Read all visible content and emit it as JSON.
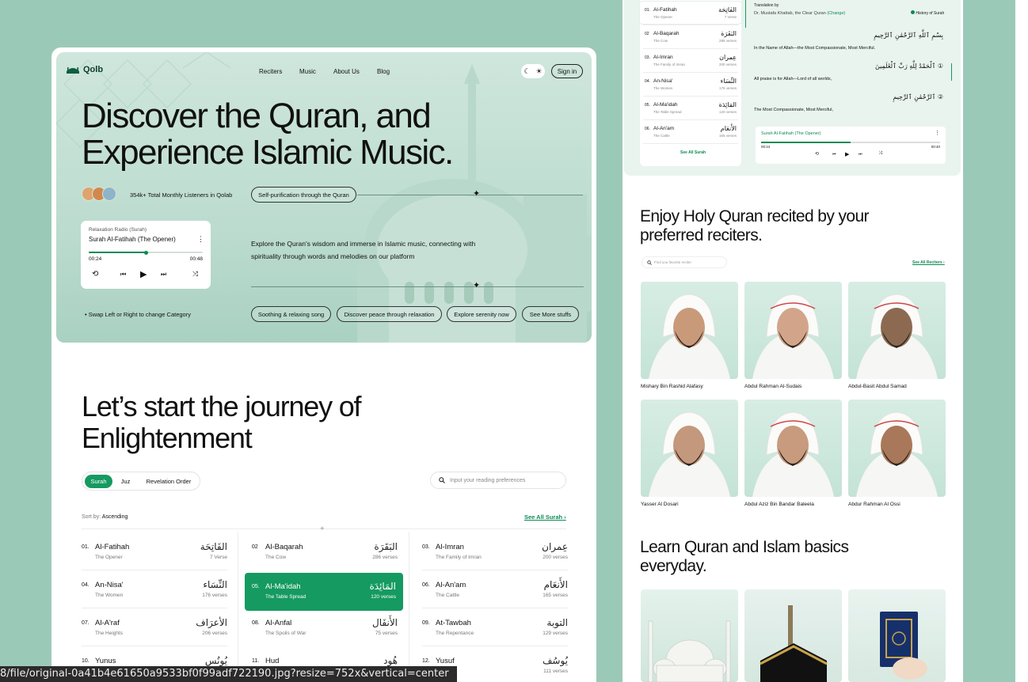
{
  "nav": {
    "brand": "Qolb",
    "links": [
      "Reciters",
      "Music",
      "About Us",
      "Blog"
    ],
    "signin": "Sign in"
  },
  "hero": {
    "title": "Discover the Quran, and Experience Islamic Music.",
    "listeners": "354k+ Total Monthly Listeners in Qolab",
    "tag": "Self-purification through the Quran",
    "description": "Explore the Quran's wisdom and immerse in Islamic music, connecting with spirituality through words and melodies on our platform",
    "swap_hint": "Swap Left or Right to change Category",
    "pills": [
      "Soothing & relaxing song",
      "Discover peace through relaxation",
      "Explore serenity now",
      "See More stuffs"
    ],
    "player": {
      "category": "Relaxation Radio (Surah)",
      "track": "Surah Al-Fatihah (The Opener)",
      "elapsed": "00:24",
      "total": "00:48",
      "progress": 0.5
    }
  },
  "journey": {
    "title": "Let’s start the journey of Enlightenment",
    "tabs": [
      "Surah",
      "Juz",
      "Revelation Order"
    ],
    "search_placeholder": "Input your reading preferences",
    "sort_label": "Sort by:",
    "sort_value": "Ascending",
    "see_all": "See All Surah",
    "surahs": [
      {
        "num": "01.",
        "name": "Al-Fatihah",
        "meaning": "The Opener",
        "arabic": "الفَاتِحَة",
        "verses": "7 Verse"
      },
      {
        "num": "02",
        "name": "Al-Baqarah",
        "meaning": "The Cow",
        "arabic": "البَقَرَة",
        "verses": "286 verses"
      },
      {
        "num": "03.",
        "name": "Al-Imran",
        "meaning": "The Family of Imran",
        "arabic": "عِمران",
        "verses": "200 verses"
      },
      {
        "num": "04.",
        "name": "An-Nisa'",
        "meaning": "The Women",
        "arabic": "النِّسَاء",
        "verses": "176 verses"
      },
      {
        "num": "05.",
        "name": "Al-Ma'idah",
        "meaning": "The Table Spread",
        "arabic": "المَائِدَة",
        "verses": "120 verses"
      },
      {
        "num": "06.",
        "name": "Al-An'am",
        "meaning": "The Cattle",
        "arabic": "الأَنعَام",
        "verses": "165 verses"
      },
      {
        "num": "07.",
        "name": "Al-A'raf",
        "meaning": "The Heights",
        "arabic": "الأعرَاف",
        "verses": "206 verses"
      },
      {
        "num": "08.",
        "name": "Al-Anfal",
        "meaning": "The Spoils of War",
        "arabic": "الأَنفَال",
        "verses": "75 verses"
      },
      {
        "num": "09.",
        "name": "At-Tawbah",
        "meaning": "The Repentance",
        "arabic": "التوبة",
        "verses": "129 verses"
      },
      {
        "num": "10.",
        "name": "Yunus",
        "meaning": "",
        "arabic": "يُونُس",
        "verses": ""
      },
      {
        "num": "11.",
        "name": "Hud",
        "meaning": "",
        "arabic": "هُود",
        "verses": ""
      },
      {
        "num": "12.",
        "name": "Yusuf",
        "meaning": "",
        "arabic": "يُوسُف",
        "verses": "111 verses"
      }
    ]
  },
  "reader": {
    "list": [
      {
        "num": "01.",
        "name": "Al-Fatihah",
        "meaning": "The Opener",
        "arabic": "الفَاتِحَة",
        "verses": "7 Verse"
      },
      {
        "num": "02",
        "name": "Al-Baqarah",
        "meaning": "The Cow",
        "arabic": "البَقَرَة",
        "verses": "286 verses"
      },
      {
        "num": "03.",
        "name": "Al-Imran",
        "meaning": "The Family of Imran",
        "arabic": "عِمران",
        "verses": "200 verses"
      },
      {
        "num": "04.",
        "name": "An-Nisa'",
        "meaning": "The Women",
        "arabic": "النِّسَاء",
        "verses": "176 verses"
      },
      {
        "num": "05.",
        "name": "Al-Ma'idah",
        "meaning": "The Table Spread",
        "arabic": "المَائِدَة",
        "verses": "120 verses"
      },
      {
        "num": "06.",
        "name": "Al-An'am",
        "meaning": "The Cattle",
        "arabic": "الأَنعَام",
        "verses": "165 verses"
      }
    ],
    "see_all": "See All Surah",
    "translation_label": "Translation by",
    "translator": "Dr. Mustafa Khattab, the Clear Quran",
    "change": "(Change)",
    "history": "History of Surah",
    "verses": [
      {
        "arabic": "بِسْمِ ٱللَّهِ ٱلرَّحْمَٰنِ ٱلرَّحِيمِ",
        "english": "In the Name of Allah—the Most Compassionate, Most Merciful."
      },
      {
        "arabic": "ٱلْحَمْدُ لِلَّهِ رَبِّ ٱلْعَٰلَمِينَ ①",
        "english": "All praise is for Allah—Lord of all worlds,"
      },
      {
        "arabic": "ٱلرَّحْمَٰنِ ٱلرَّحِيمِ ②",
        "english": "The Most Compassionate, Most Merciful,"
      }
    ],
    "mini_player": {
      "track": "Surah Al-Fatihah (The Opener)",
      "elapsed": "00:24",
      "total": "00:40"
    }
  },
  "reciters": {
    "title": "Enjoy Holy Quran recited by your preferred reciters.",
    "search_placeholder": "Find you favorite reciter",
    "see_all": "See All Reciters",
    "names": [
      "Mishary Bin Rashid Alafasy",
      "Abdul Rahman Al-Sudais",
      "Abdul-Basit Abdul Samad",
      "Yasser Al Dosari",
      "Abdul Aziz Bin Bandar Baleela",
      "Abdur Rahman Al Ossi"
    ]
  },
  "learn": {
    "title": "Learn Quran and Islam basics everyday."
  },
  "status_url": "8/file/original-0a41b4e61650a9533bf0f99adf722190.jpg?resize=752x&vertical=center",
  "colors": {
    "accent": "#159a61",
    "background": "#9bc9b8",
    "hero": "#c3e0d4"
  },
  "icons": {
    "logo": "mosque-icon",
    "theme": "moon-sun-icon",
    "search": "search-icon",
    "menu": "more-vertical-icon",
    "star": "sparkle-icon"
  }
}
